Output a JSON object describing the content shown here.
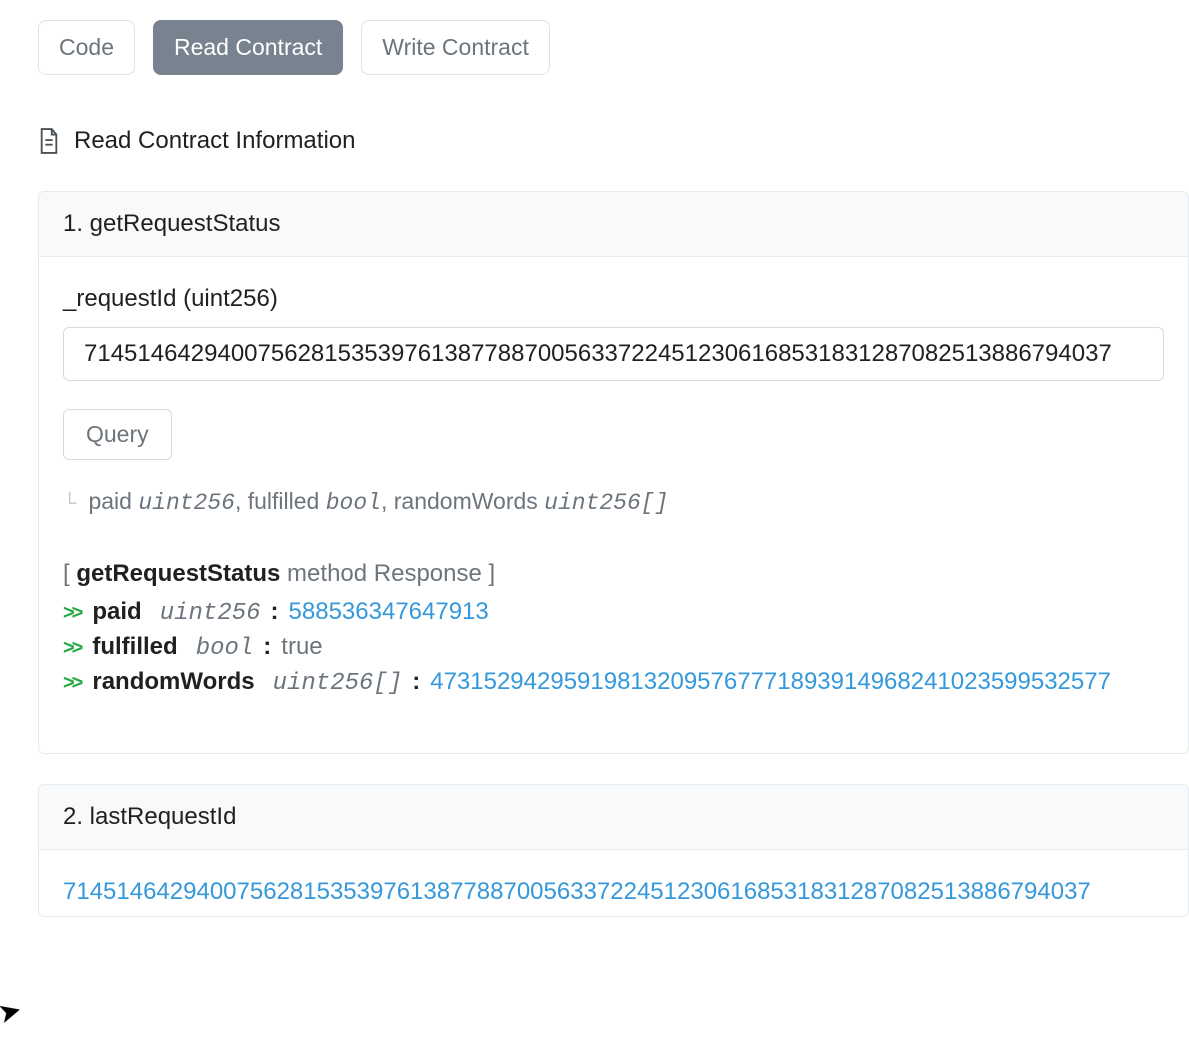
{
  "tabs": {
    "code": "Code",
    "read": "Read Contract",
    "write": "Write Contract"
  },
  "sectionTitle": "Read Contract Information",
  "method1": {
    "headerLabel": "1. getRequestStatus",
    "inputLabel": "_requestId (uint256)",
    "inputValue": "71451464294007562815353976138778870056337224512306168531831287082513886794037",
    "queryLabel": "Query",
    "returns": {
      "paidName": "paid",
      "paidType": "uint256",
      "sep1": ", ",
      "fulfilledName": "fulfilled",
      "fulfilledType": "bool",
      "sep2": ", ",
      "randomWordsName": "randomWords",
      "randomWordsType": "uint256[]"
    },
    "response": {
      "open": "[ ",
      "methodName": "getRequestStatus",
      "suffix": " method Response ]",
      "paid": {
        "name": "paid",
        "type": "uint256",
        "value": "588536347647913"
      },
      "fulfilled": {
        "name": "fulfilled",
        "type": "bool",
        "value": "true"
      },
      "randomWords": {
        "name": "randomWords",
        "type": "uint256[]",
        "value": "473152942959198132095767771893914968241023599532577"
      }
    }
  },
  "method2": {
    "headerLabel": "2. lastRequestId",
    "value": "71451464294007562815353976138778870056337224512306168531831287082513886794037"
  }
}
